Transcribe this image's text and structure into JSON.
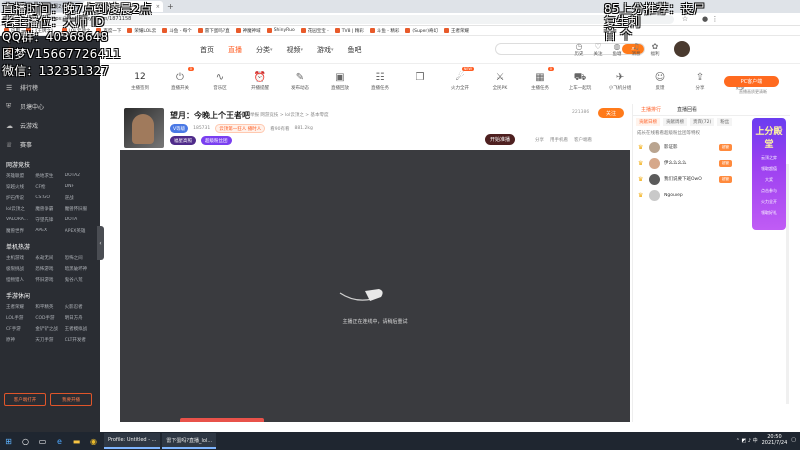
{
  "browser": {
    "tabs": [
      {
        "title": "直播时间：晚7点到凌晨2点"
      },
      {
        "title": ""
      }
    ],
    "url": "https://www.douyu.com/1871158",
    "bookmarks": [
      "应用",
      "《王牌之》",
      "LOL云顶之",
      "百度一下",
      "荣耀LOL云",
      "斗鱼 - 每个",
      "雷下蛋吗?直",
      "神魔神域",
      "ShinyRuo",
      "花园宝宝 -",
      "TV8 | 精彩",
      "斗鱼 - 精彩",
      "(Super)奇幻",
      "王者荣耀"
    ]
  },
  "header": {
    "nav": [
      {
        "label": "首页",
        "active": false
      },
      {
        "label": "直播",
        "active": true
      },
      {
        "label": "分类",
        "active": false
      },
      {
        "label": "视频",
        "active": false
      },
      {
        "label": "游戏",
        "active": false
      },
      {
        "label": "鱼吧",
        "active": false
      }
    ],
    "search_placeholder": "",
    "icons": [
      {
        "label": "历史",
        "icon": "clock-icon"
      },
      {
        "label": "关注",
        "icon": "heart-icon"
      },
      {
        "label": "鱼塘",
        "icon": "fish-icon"
      },
      {
        "label": "消息",
        "icon": "bell-icon"
      },
      {
        "label": "福利",
        "icon": "gift-icon"
      }
    ]
  },
  "sidebar": {
    "items": [
      {
        "label": "排行榜",
        "icon": "list-icon"
      },
      {
        "label": "贝塘中心",
        "icon": "shield-icon"
      },
      {
        "label": "云游戏",
        "icon": "cloud-icon"
      },
      {
        "label": "赛事",
        "icon": "trophy-icon"
      }
    ],
    "sections": [
      {
        "title": "网游竞技",
        "items": [
          "英雄联盟",
          "绝地求生",
          "DOTA2",
          "穿越火线",
          "CF枪",
          "DNF",
          "炉石传说",
          "CS:GO",
          "逆战",
          "lol云顶之",
          "魔兽争霸",
          "魔兽怀旧服",
          "VALORA...",
          "守望先锋",
          "DOTA",
          "魔兽世界",
          "APEX",
          "APEX英雄"
        ]
      },
      {
        "title": "单机热游",
        "items": [
          "主机游戏",
          "永劫无间",
          "恐怖之间",
          "极限挑战",
          "恐怖游戏",
          "暗黑破坏神",
          "怪物猎人",
          "怀旧游戏",
          "鬼谷八荒"
        ]
      },
      {
        "title": "手游休闲",
        "items": [
          "王者荣耀",
          "和平精英",
          "火影忍者",
          "LOL手游",
          "COD手游",
          "明日方舟",
          "CF手游",
          "金铲铲之战",
          "王者模拟战",
          "原神",
          "天刀手游",
          "CLT开发者"
        ]
      }
    ],
    "bottom_buttons": [
      "客户端打开",
      "我要开播"
    ]
  },
  "category_bar": {
    "date_label": "12",
    "date_sub": "主播签到",
    "items": [
      {
        "label": "直播开关",
        "icon": "power-icon",
        "badge": "0"
      },
      {
        "label": "音乐区",
        "icon": "wave-icon"
      },
      {
        "label": "开播提醒",
        "icon": "alarm-icon"
      },
      {
        "label": "发布动态",
        "icon": "edit-icon"
      },
      {
        "label": "直播回放",
        "icon": "image-icon"
      },
      {
        "label": "直播任务",
        "icon": "task-icon"
      },
      {
        "label": "",
        "icon": "gift-icon"
      },
      {
        "label": "火力全开",
        "icon": "fire-icon",
        "badge": "NEW"
      },
      {
        "label": "全民PK",
        "icon": "pk-icon"
      },
      {
        "label": "主播任务",
        "icon": "cal-icon",
        "badge": "0"
      },
      {
        "label": "上车一起玩",
        "icon": "car-icon"
      },
      {
        "label": "小飞机分组",
        "icon": "plane-icon"
      },
      {
        "label": "反馈",
        "icon": "chat-icon"
      },
      {
        "label": "分享",
        "icon": "share-icon"
      },
      {
        "label": "更多",
        "icon": "more-icon"
      }
    ],
    "pc_client": "PC客户端",
    "pc_sub": "直播画质更清晰"
  },
  "room": {
    "title": "望月：今晚上个王者吧",
    "meta": "举报  网游竞技 > lol云顶之 > 基本零度",
    "hot": "185731",
    "fans_level": "2",
    "follow": "关注",
    "follow_count": "221386",
    "vip_label": "V等级",
    "share": "分享",
    "mobile": "用手机看",
    "client": "客户端看",
    "badge_a": "福星高照",
    "badge_b": "超级粉丝团",
    "tag1": "云顶第一狂人 播时人",
    "tag2": "看90有看",
    "fans": "881.2kg",
    "pill_now": "开始准播"
  },
  "player": {
    "message": "主播正在连线中，请稍后重试"
  },
  "right_panel": {
    "tabs": [
      {
        "label": "主播排行",
        "on": true
      },
      {
        "label": "直播回看",
        "on": false
      }
    ],
    "subtabs": [
      {
        "label": "贡献日榜",
        "on": true
      },
      {
        "label": "贡献周榜",
        "on": false
      },
      {
        "label": "贵宾(72)",
        "on": false
      },
      {
        "label": "粉丝",
        "on": false
      }
    ],
    "fans_title": "成长在线看看超级粉丝团等特权",
    "fans_btn": "超级粉丝团",
    "rows": [
      {
        "rank": "♛",
        "name": "影证影",
        "tag": "超管",
        "value": "17537"
      },
      {
        "rank": "♛",
        "name": "伊么么么么",
        "tag": "超管",
        "value": "1635"
      },
      {
        "rank": "♛",
        "name": "我们说要下班OwO",
        "tag": "超管",
        "value": "1535"
      },
      {
        "rank": "♛",
        "name": "Ngouiep",
        "tag": "",
        "value": ""
      }
    ],
    "promo_title": "上分殿堂",
    "promo_lines": [
      "云顶之弈",
      "领取超值",
      "大奖",
      "点击参与",
      "火力全开",
      "领取好礼"
    ]
  },
  "overlay": {
    "line1": "直播时间：晚7点到凌晨2点",
    "line2": "老主播位：大师 ID",
    "line3": "QQ群：40368648",
    "line4": "图梦V15667726411",
    "line5": "微信：132351327",
    "right1": "85上分推荐：丧尸",
    "right2": "复生刺",
    "right3": "首",
    "right4": "个"
  },
  "taskbar": {
    "apps": [
      {
        "label": "Profile: Untitled - ..."
      },
      {
        "label": "雷下蛋吗?直播_lol..."
      }
    ],
    "time": "20:50",
    "date": "2021/7/24"
  }
}
